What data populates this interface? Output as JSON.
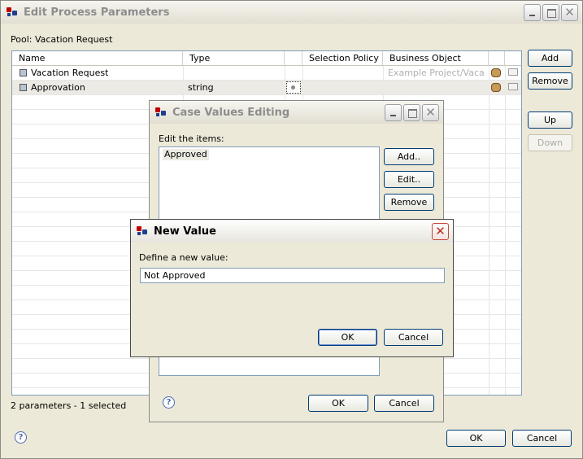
{
  "main_window": {
    "title": "Edit Process Parameters",
    "pool_label": "Pool: Vacation Request",
    "columns": [
      "Name",
      "Type",
      "Selection Policy",
      "Business Object"
    ],
    "rows": [
      {
        "name": "Vacation Request",
        "type": "",
        "business_object": "Example Project/Vaca..."
      },
      {
        "name": "Approvation",
        "type": "string",
        "business_object": ""
      }
    ],
    "buttons": {
      "add": "Add",
      "remove": "Remove",
      "up": "Up",
      "down": "Down",
      "ok": "OK",
      "cancel": "Cancel"
    },
    "status": "2 parameters - 1  selected"
  },
  "case_values_dialog": {
    "title": "Case Values Editing",
    "edit_label": "Edit the items:",
    "items": [
      "Approved"
    ],
    "buttons": {
      "add": "Add..",
      "edit": "Edit..",
      "remove": "Remove",
      "ok": "OK",
      "cancel": "Cancel"
    }
  },
  "new_value_dialog": {
    "title": "New Value",
    "prompt": "Define a new value:",
    "value": "Not Approved",
    "buttons": {
      "ok": "OK",
      "cancel": "Cancel"
    }
  }
}
